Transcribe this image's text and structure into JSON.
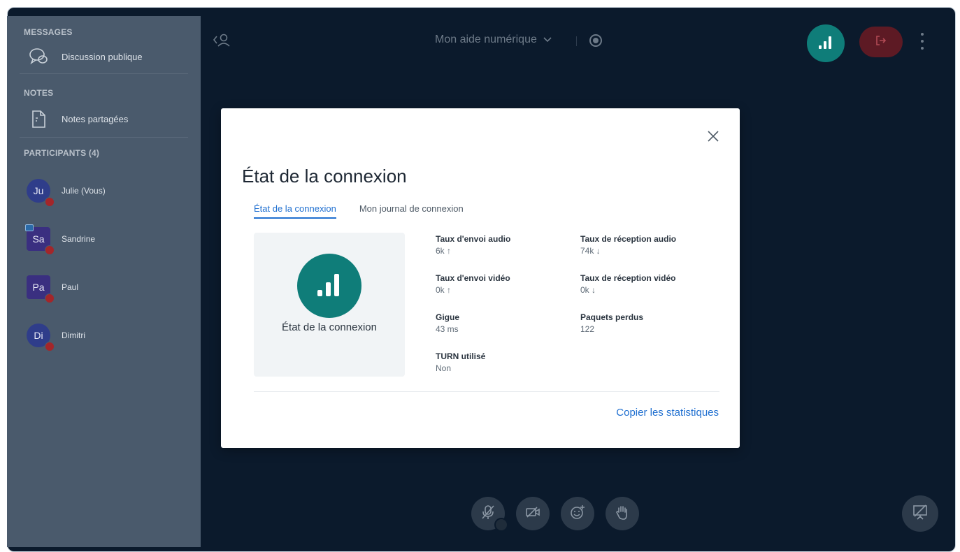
{
  "sidebar": {
    "messages_title": "MESSAGES",
    "public_chat_label": "Discussion publique",
    "notes_title": "NOTES",
    "shared_notes_label": "Notes partagées",
    "participants_title": "PARTICIPANTS (4)",
    "participants": [
      {
        "initials": "Ju",
        "name": "Julie (Vous)",
        "moderator": false
      },
      {
        "initials": "Sa",
        "name": "Sandrine",
        "moderator": true
      },
      {
        "initials": "Pa",
        "name": "Paul",
        "moderator": false
      },
      {
        "initials": "Di",
        "name": "Dimitri",
        "moderator": false
      }
    ]
  },
  "topbar": {
    "room_title": "Mon aide numérique",
    "room_title_icon": "chevron-down-icon",
    "record_icon": "record-icon",
    "connection_icon": "signal-bars-icon",
    "leave_icon": "leave-icon",
    "options_icon": "vertical-dots-icon"
  },
  "actions": {
    "mic_icon": "mic-muted-icon",
    "camera_icon": "camera-off-icon",
    "reactions_icon": "emoji-add-icon",
    "raise_hand_icon": "raise-hand-icon",
    "presentation_icon": "presentation-hidden-icon"
  },
  "modal": {
    "title": "État de la connexion",
    "close_icon": "close-icon",
    "tabs": [
      {
        "label": "État de la connexion",
        "active": true
      },
      {
        "label": "Mon journal de connexion",
        "active": false
      }
    ],
    "status_label": "État de la connexion",
    "stats": {
      "audio_send_label": "Taux d'envoi audio",
      "audio_send_value": "6k ↑",
      "audio_recv_label": "Taux de réception audio",
      "audio_recv_value": "74k ↓",
      "video_send_label": "Taux d'envoi vidéo",
      "video_send_value": "0k ↑",
      "video_recv_label": "Taux de réception vidéo",
      "video_recv_value": "0k ↓",
      "jitter_label": "Gigue",
      "jitter_value": "43 ms",
      "lost_label": "Paquets perdus",
      "lost_value": "122",
      "turn_label": "TURN utilisé",
      "turn_value": "Non"
    },
    "copy_label": "Copier les statistiques"
  },
  "colors": {
    "accent": "#0f7d79",
    "link": "#1f6fd0",
    "leave": "#5d1a24",
    "background": "#0b1a2c",
    "sidebar": "#4a5a6c"
  }
}
